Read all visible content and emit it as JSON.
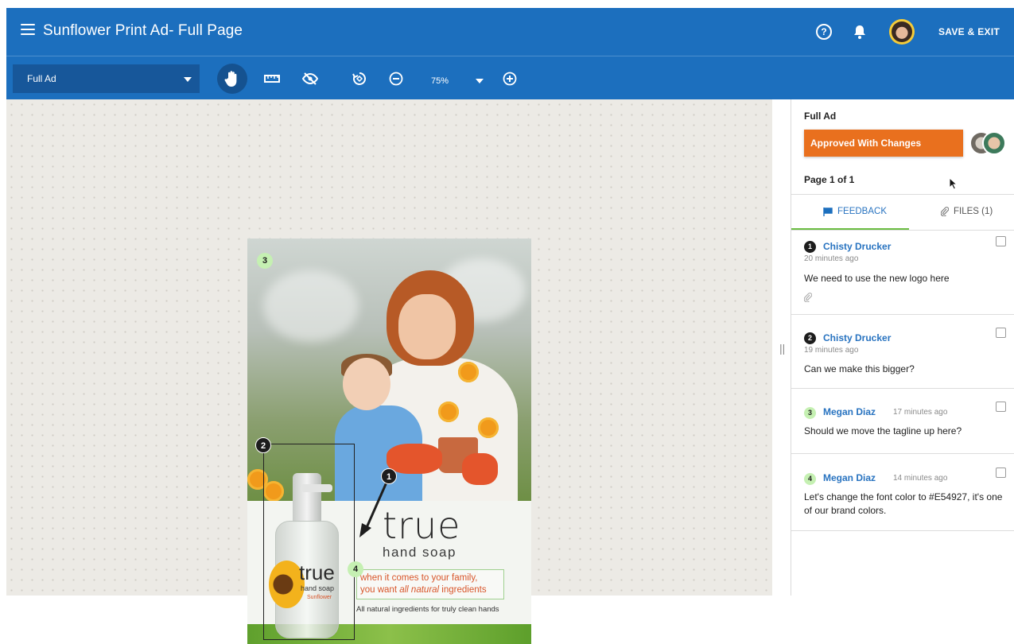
{
  "header": {
    "title": "Sunflower Print Ad- Full Page",
    "save_exit": "SAVE & EXIT",
    "help_glyph": "?"
  },
  "toolbar": {
    "view_select": "Full Ad",
    "zoom": "75%",
    "tools": [
      "hand-icon",
      "ruler-icon",
      "hide-icon",
      "rotate-icon",
      "zoom-out-icon",
      "zoom-in-icon"
    ]
  },
  "ad": {
    "brand": "true",
    "brand_sub": "hand soap",
    "tagline_line1": "when it comes to your family,",
    "tagline_line2_pre": "you want ",
    "tagline_line2_em": "all natural",
    "tagline_line2_post": " ingredients",
    "footer": "All natural ingredients for truly clean hands",
    "bottle_brand": "true",
    "bottle_sub": "hand soap",
    "bottle_variant": "Sunflower",
    "pins": [
      "1",
      "2",
      "3",
      "4"
    ]
  },
  "panel": {
    "section_title": "Full Ad",
    "status": "Approved With Changes",
    "page_info": "Page 1 of 1",
    "tab_feedback": "FEEDBACK",
    "tab_files": "FILES (1)",
    "comments": [
      {
        "num": "1",
        "author": "Chisty Drucker",
        "time": "20 minutes ago",
        "text": "We need to use the new logo here"
      },
      {
        "num": "2",
        "author": "Chisty Drucker",
        "time": "19 minutes ago",
        "text": "Can we make this bigger?"
      },
      {
        "num": "3",
        "author": "Megan Diaz",
        "time": "17 minutes ago",
        "text": "Should we move the tagline up here?"
      },
      {
        "num": "4",
        "author": "Megan Diaz",
        "time": "14 minutes ago",
        "text": "Let's change the font color to #E54927, it's one of our brand colors."
      }
    ]
  },
  "colors": {
    "header_blue": "#1c6fbe",
    "status_orange": "#e9701e",
    "link_blue": "#2873c0",
    "tab_green": "#6bbd43"
  }
}
